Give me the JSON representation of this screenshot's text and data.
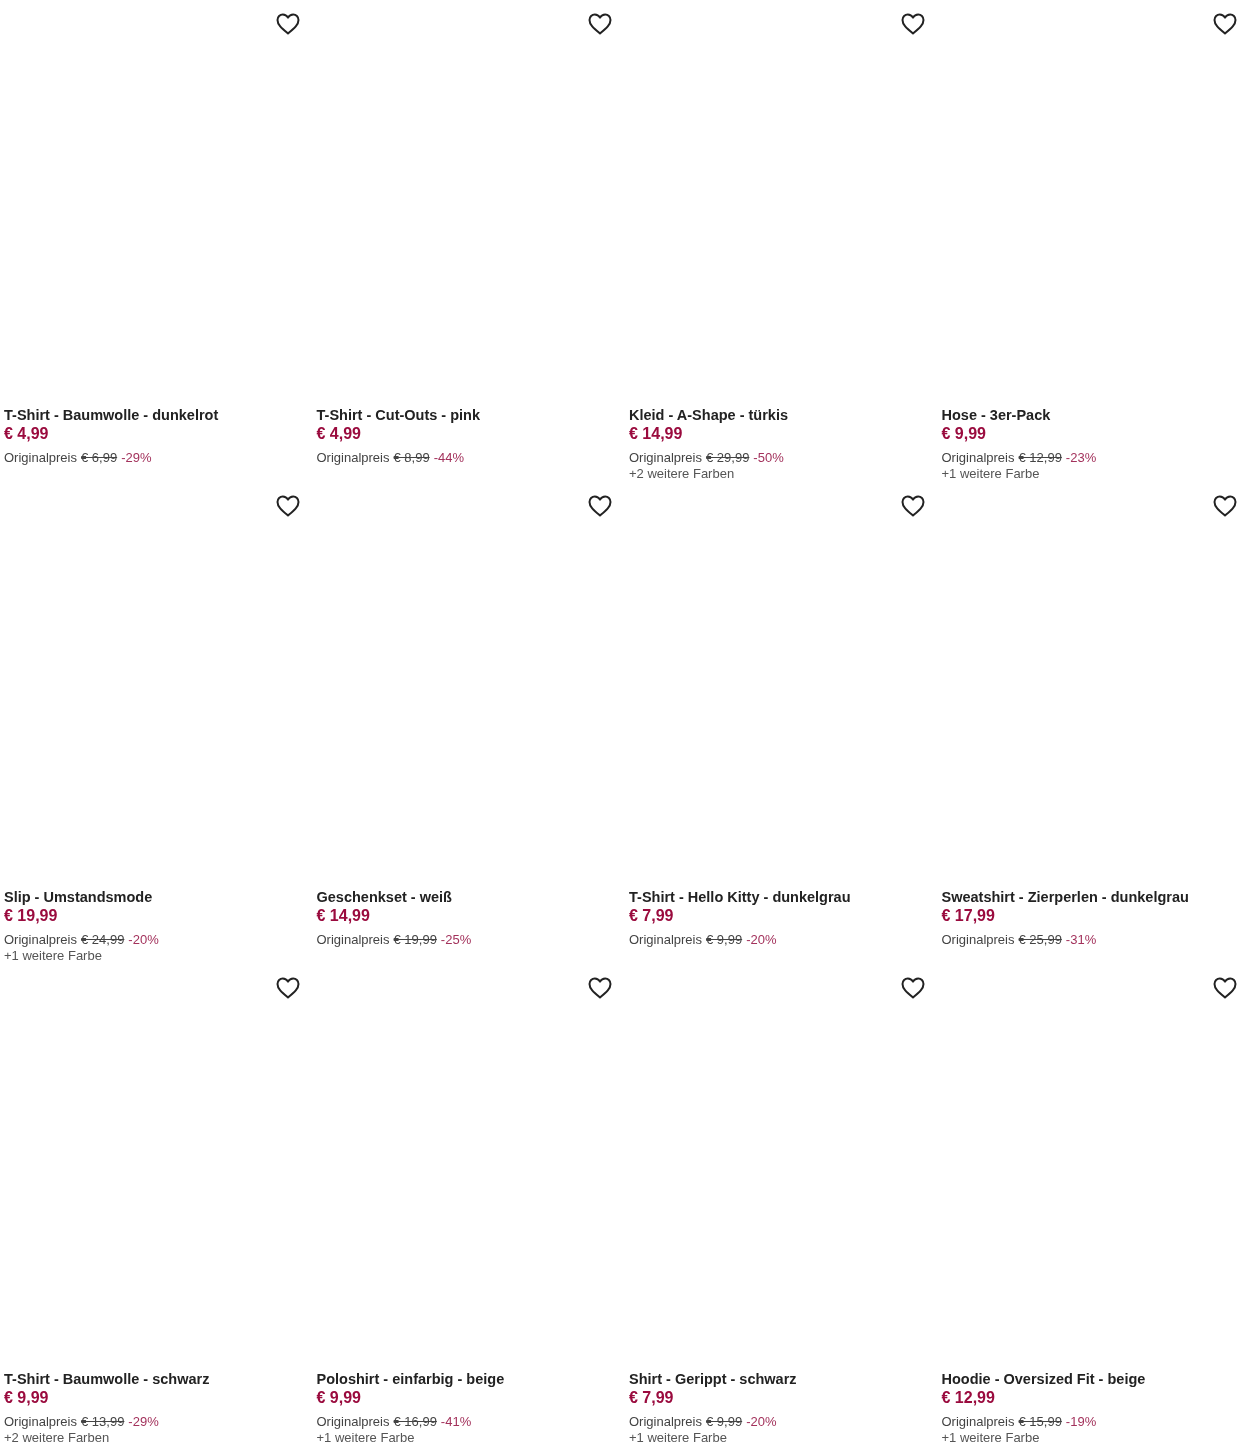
{
  "products": [
    {
      "title": "T-Shirt - Baumwolle - dunkelrot",
      "price": "€ 4,99",
      "original_label": "Originalpreis",
      "original_price": "€ 6,99",
      "discount": "-29%",
      "wishlisted": false
    },
    {
      "title": "T-Shirt - Cut-Outs - pink",
      "price": "€ 4,99",
      "original_label": "Originalpreis",
      "original_price": "€ 8,99",
      "discount": "-44%",
      "wishlisted": false
    },
    {
      "title": "Kleid - A-Shape - türkis",
      "price": "€ 14,99",
      "original_label": "Originalpreis",
      "original_price": "€ 29,99",
      "discount": "-50%",
      "more_colors": "+2 weitere Farben",
      "wishlisted": false
    },
    {
      "title": "Hose - 3er-Pack",
      "price": "€ 9,99",
      "original_label": "Originalpreis",
      "original_price": "€ 12,99",
      "discount": "-23%",
      "more_colors": "+1 weitere Farbe",
      "wishlisted": false
    },
    {
      "title": "Slip - Umstandsmode",
      "price": "€ 19,99",
      "original_label": "Originalpreis",
      "original_price": "€ 24,99",
      "discount": "-20%",
      "more_colors": "+1 weitere Farbe",
      "wishlisted": false
    },
    {
      "title": "Geschenkset - weiß",
      "price": "€ 14,99",
      "original_label": "Originalpreis",
      "original_price": "€ 19,99",
      "discount": "-25%",
      "wishlisted": false
    },
    {
      "title": "T-Shirt - Hello Kitty - dunkelgrau",
      "price": "€ 7,99",
      "original_label": "Originalpreis",
      "original_price": "€ 9,99",
      "discount": "-20%",
      "wishlisted": false
    },
    {
      "title": "Sweatshirt - Zierperlen - dunkelgrau",
      "price": "€ 17,99",
      "original_label": "Originalpreis",
      "original_price": "€ 25,99",
      "discount": "-31%",
      "wishlisted": false
    },
    {
      "title": "T-Shirt - Baumwolle - schwarz",
      "price": "€ 9,99",
      "original_label": "Originalpreis",
      "original_price": "€ 13,99",
      "discount": "-29%",
      "more_colors": "+2 weitere Farben",
      "wishlisted": false
    },
    {
      "title": "Poloshirt - einfarbig - beige",
      "price": "€ 9,99",
      "original_label": "Originalpreis",
      "original_price": "€ 16,99",
      "discount": "-41%",
      "more_colors": "+1 weitere Farbe",
      "wishlisted": false
    },
    {
      "title": "Shirt - Gerippt - schwarz",
      "price": "€ 7,99",
      "original_label": "Originalpreis",
      "original_price": "€ 9,99",
      "discount": "-20%",
      "more_colors": "+1 weitere Farbe",
      "wishlisted": false
    },
    {
      "title": "Hoodie - Oversized Fit - beige",
      "price": "€ 12,99",
      "original_label": "Originalpreis",
      "original_price": "€ 15,99",
      "discount": "-19%",
      "more_colors": "+1 weitere Farbe",
      "wishlisted": false
    }
  ]
}
